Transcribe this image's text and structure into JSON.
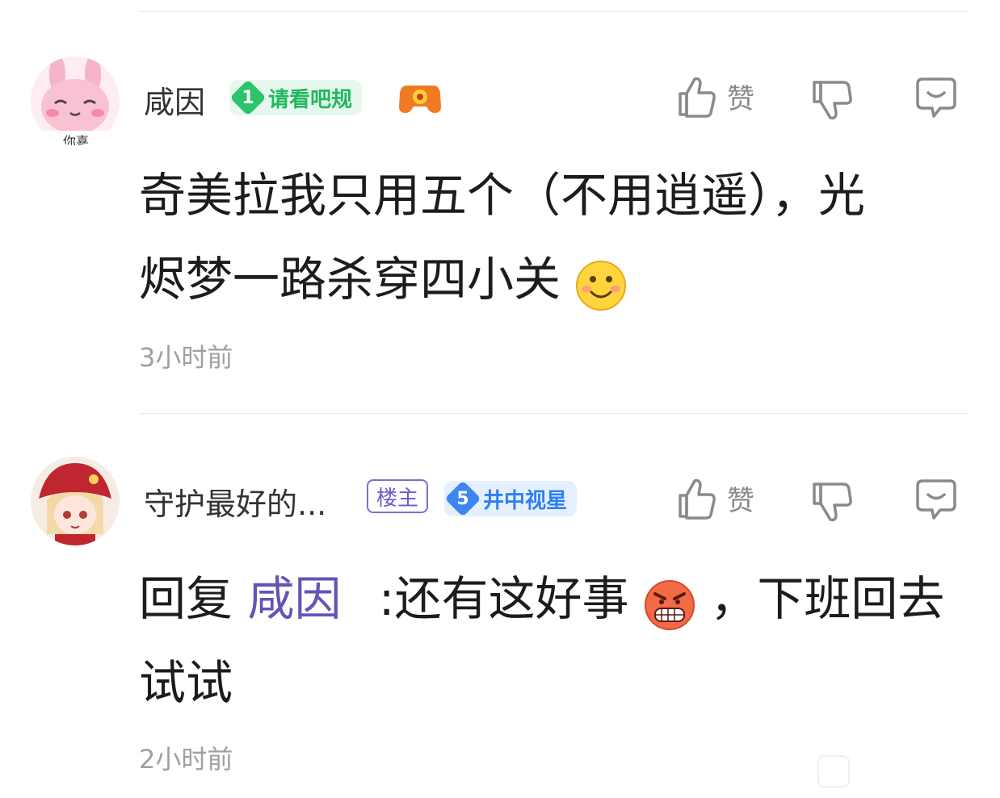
{
  "comments": [
    {
      "username": "咸因",
      "level_number": "1",
      "level_title": "请看吧规",
      "like_label": "赞",
      "content_line1": "奇美拉我只用五个（不用逍遥），光",
      "content_line2": "烬梦一路杀穿四小关",
      "emoji": "smile-emoji",
      "time": "3小时前",
      "avatar_caption": "你喜"
    },
    {
      "username": "守护最好的...",
      "owner_tag": "楼主",
      "level_number": "5",
      "level_title": "井中视星",
      "like_label": "赞",
      "reply_prefix": "回复",
      "reply_target": "咸因",
      "content_line1_a": ":还有这好事",
      "content_line1_b": "，下班回去",
      "content_line2": "试试",
      "emoji": "grimace-emoji",
      "time": "2小时前"
    }
  ],
  "colors": {
    "level1_badge_bg": "#e6f8ee",
    "level1_badge_fg": "#1fb85e",
    "level5_badge_bg": "#e4f0ff",
    "level5_badge_fg": "#2f7ff0",
    "mention": "#6354b8",
    "owner_tag": "#6a5cc6"
  }
}
